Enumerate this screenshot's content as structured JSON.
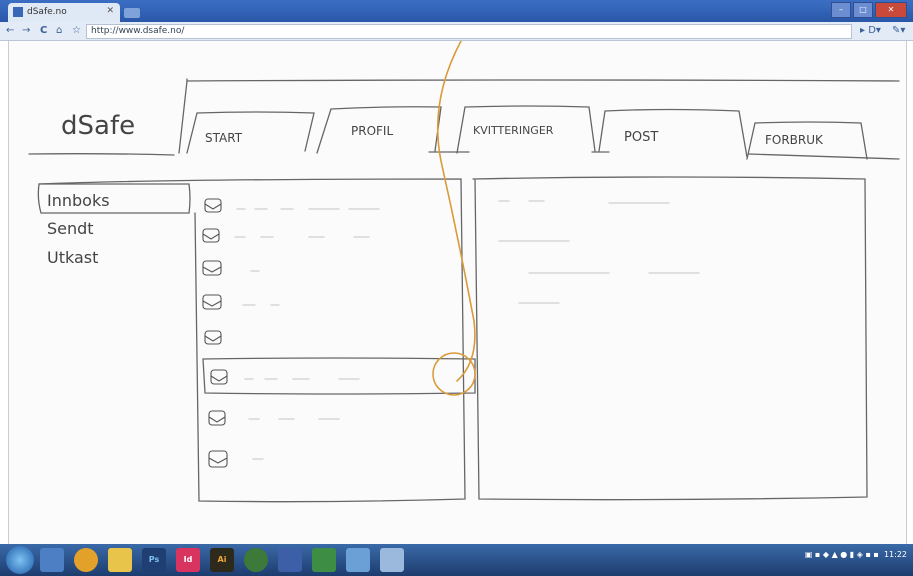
{
  "browser": {
    "tab_title": "dSafe.no",
    "url": "http://www.dsafe.no/",
    "nav": {
      "back": "←",
      "forward": "→",
      "reload": "C",
      "home": "⌂",
      "star": "☆"
    }
  },
  "app": {
    "logo": "dSafe",
    "tabs": [
      {
        "label": "START"
      },
      {
        "label": "PROFIL"
      },
      {
        "label": "KVITTERINGER"
      },
      {
        "label": "POST"
      },
      {
        "label": "FORBRUK"
      }
    ],
    "folders": [
      {
        "label": "Innboks"
      },
      {
        "label": "Sendt"
      },
      {
        "label": "Utkast"
      }
    ]
  },
  "taskbar": {
    "clock": "11:22"
  }
}
